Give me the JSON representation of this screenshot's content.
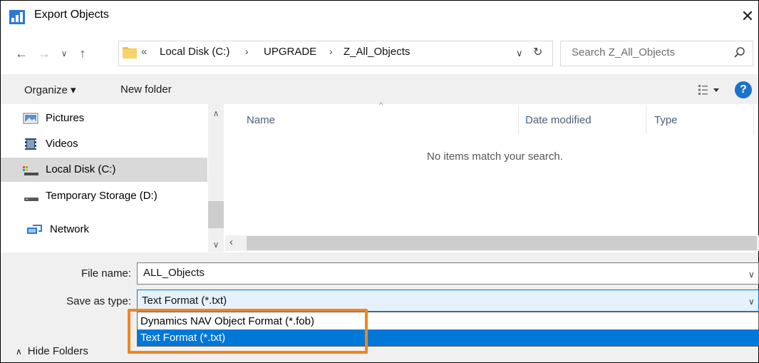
{
  "window": {
    "title": "Export Objects",
    "close_label": "✕"
  },
  "address": {
    "overflow": "«",
    "crumbs": [
      "Local Disk (C:)",
      "UPGRADE",
      "Z_All_Objects"
    ],
    "separator": "›"
  },
  "search": {
    "placeholder": "Search Z_All_Objects"
  },
  "toolbar": {
    "organize_label": "Organize ▾",
    "new_folder_label": "New folder",
    "help_label": "?"
  },
  "nav_pane": {
    "items": [
      {
        "label": "Pictures",
        "icon": "pictures-icon"
      },
      {
        "label": "Videos",
        "icon": "videos-icon"
      },
      {
        "label": "Local Disk (C:)",
        "icon": "local-disk-icon",
        "selected": true
      },
      {
        "label": "Temporary Storage (D:)",
        "icon": "drive-icon"
      },
      {
        "label": "Network",
        "icon": "network-icon"
      }
    ]
  },
  "file_list": {
    "columns": [
      "Name",
      "Date modified",
      "Type"
    ],
    "empty_message": "No items match your search."
  },
  "form": {
    "file_name_label": "File name:",
    "file_name_value": "ALL_Objects",
    "save_type_label": "Save as type:",
    "save_type_value": "Text Format (*.txt)"
  },
  "type_options": [
    {
      "label": "Dynamics NAV Object Format (*.fob)",
      "selected": false
    },
    {
      "label": "Text Format (*.txt)",
      "selected": true
    }
  ],
  "footer": {
    "hide_folders_label": "Hide Folders"
  },
  "colors": {
    "accent": "#0078d7",
    "highlight": "#f08422",
    "help": "#1a73c8"
  }
}
